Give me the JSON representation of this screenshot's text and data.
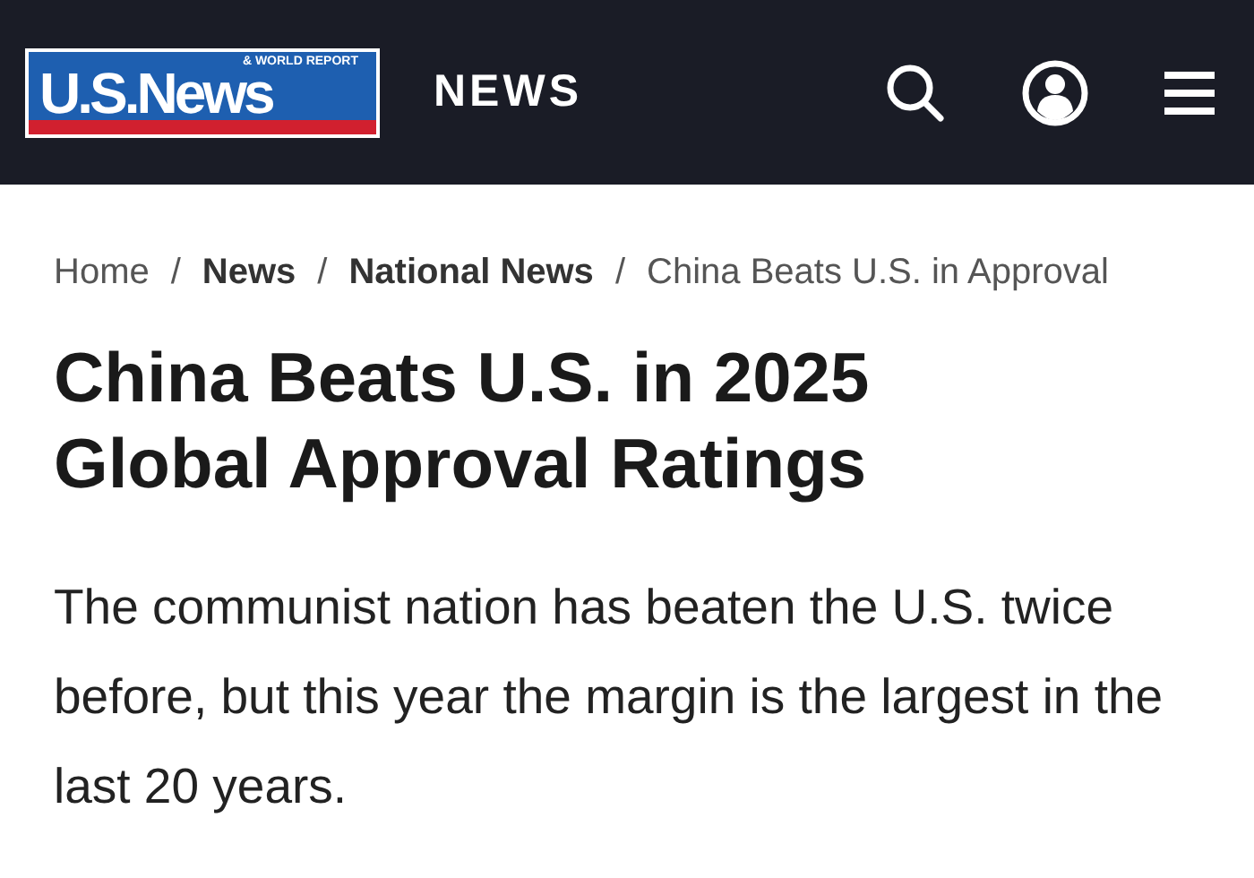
{
  "header": {
    "logo": {
      "wordmark": "U.S.News",
      "tagline": "& WORLD REPORT"
    },
    "section": "NEWS"
  },
  "breadcrumb": [
    {
      "label": "Home",
      "bold": false
    },
    {
      "label": "News",
      "bold": true
    },
    {
      "label": "National News",
      "bold": true
    },
    {
      "label": "China Beats U.S. in Approval",
      "bold": false
    }
  ],
  "breadcrumb_separator": "/",
  "headline": "China Beats U.S. in 2025 Global Approval Ratings",
  "summary": "The communist nation has beaten the U.S. twice before, but this year the margin is the largest in the last 20 years."
}
